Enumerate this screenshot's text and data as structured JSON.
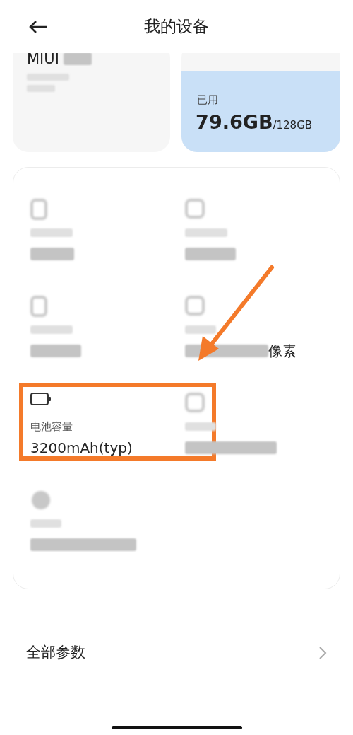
{
  "header": {
    "title": "我的设备"
  },
  "version_card": {
    "title": "MIUI"
  },
  "storage_card": {
    "used_label": "已用",
    "used": "79.6GB",
    "total": "/128GB"
  },
  "specs": [
    {
      "kind": "phone",
      "highlighted": false
    },
    {
      "kind": "chip",
      "highlighted": false
    },
    {
      "kind": "phone",
      "highlighted": false
    },
    {
      "kind": "chip",
      "unit": "像素",
      "highlighted": false
    },
    {
      "kind": "battery",
      "label": "电池容量",
      "value": "3200mAh(typ)",
      "highlighted": true
    },
    {
      "kind": "chip",
      "highlighted": false
    },
    {
      "kind": "camera",
      "highlighted": false
    }
  ],
  "all_params": {
    "label": "全部参数"
  }
}
